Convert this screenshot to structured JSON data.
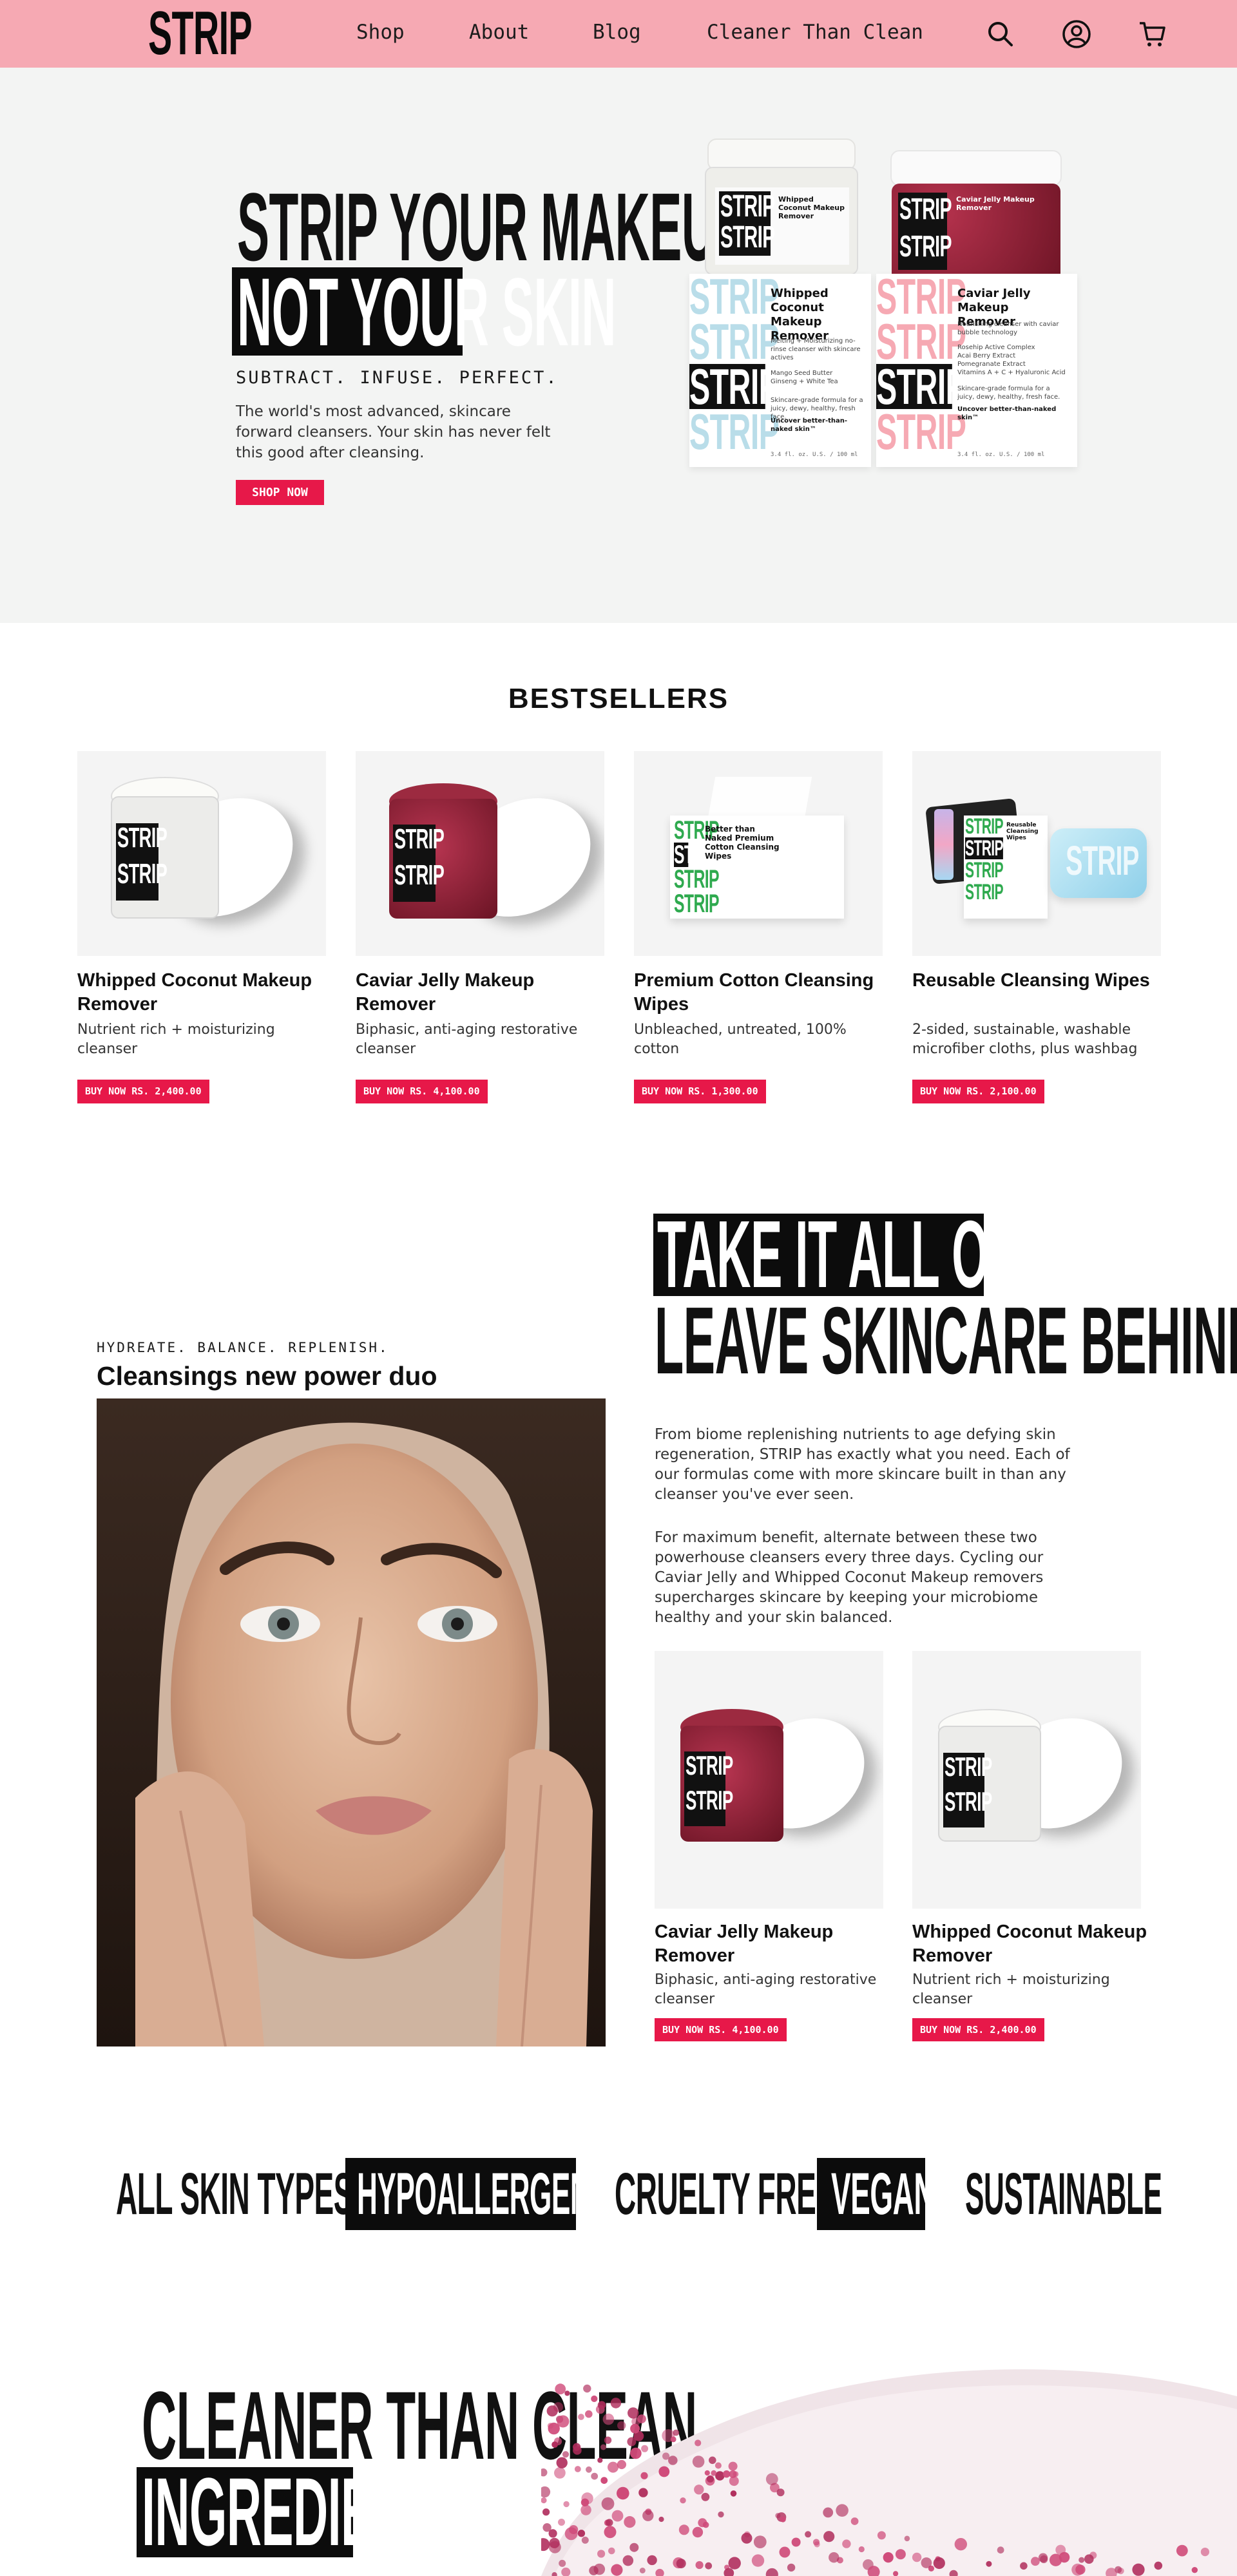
{
  "header": {
    "logo": "STRIP",
    "nav": [
      "Shop",
      "About",
      "Blog",
      "Cleaner Than Clean"
    ],
    "icons": [
      "search-icon",
      "account-icon",
      "cart-icon"
    ],
    "bg_color": "#f6a9b3"
  },
  "hero": {
    "headline_1": "STRIP YOUR MAKEUP",
    "headline_2": "NOT YOUR SKIN",
    "tagline": "SUBTRACT. INFUSE. PERFECT.",
    "description": "The world's most advanced, skincare forward cleansers. Your skin has never felt this good after cleansing.",
    "cta": "SHOP NOW",
    "box_left": {
      "brand": "STRIP",
      "title": "Whipped Coconut Makeup Remover",
      "lines": "Melting + Moisturizing no-rinse cleanser with skincare actives",
      "ingredients": "Mango Seed Butter\nGinseng + White Tea",
      "note": "Skincare-grade formula for a juicy, dewy, healthy, fresh face.",
      "slogan": "Uncover better-than-naked skin™",
      "size": "3.4 fl. oz. U.S. / 100 ml"
    },
    "box_right": {
      "brand": "STRIP",
      "title": "Caviar Jelly Makeup Remover",
      "lines": "Nourishing cleanser with caviar bubble technology",
      "ingredients": "Rosehip Active Complex\nAcai Berry Extract\nPomegranate Extract\nVitamins A + C + Hyaluronic Acid",
      "note": "Skincare-grade formula for a juicy, dewy, healthy, fresh face.",
      "slogan": "Uncover better-than-naked skin™",
      "size": "3.4 fl. oz. U.S. / 100 ml"
    },
    "jar_left_label": "Whipped Coconut Makeup Remover",
    "jar_right_label": "Caviar Jelly Makeup Remover"
  },
  "bestsellers": {
    "title": "BESTSELLERS",
    "products": [
      {
        "name": "Whipped Coconut Makeup Remover",
        "desc": "Nutrient rich + moisturizing cleanser",
        "btn": "BUY NOW   RS. 2,400.00"
      },
      {
        "name": "Caviar Jelly Makeup Remover",
        "desc": "Biphasic, anti-aging restorative cleanser",
        "btn": "BUY NOW   RS. 4,100.00"
      },
      {
        "name": "Premium Cotton Cleansing Wipes",
        "desc": "Unbleached, untreated, 100% cotton",
        "btn": "BUY NOW   RS. 1,300.00"
      },
      {
        "name": "Reusable Cleansing Wipes",
        "desc": "2-sided, sustainable, washable microfiber cloths, plus washbag",
        "btn": "BUY NOW   RS. 2,100.00"
      }
    ],
    "wipes_box_title": "Better than Naked Premium Cotton Cleansing Wipes",
    "reusable_label": "Reusable Cleansing Wipes"
  },
  "duo": {
    "tag": "HYDREATE. BALANCE. REPLENISH.",
    "title": "Cleansings new power duo",
    "headline_1": "TAKE IT ALL OFF,",
    "headline_2": "LEAVE SKINCARE BEHIND",
    "p1": "From biome replenishing nutrients to age defying skin regeneration, STRIP has exactly what you need. Each of our formulas come with more skincare built in than any cleanser you've ever seen.",
    "p2": "For maximum benefit, alternate between these two powerhouse cleansers every three days. Cycling our Caviar Jelly and Whipped Coconut Makeup removers supercharges skincare by keeping your microbiome healthy and your skin balanced.",
    "products": [
      {
        "name": "Caviar Jelly Makeup Remover",
        "desc": "Biphasic, anti-aging restorative cleanser",
        "btn": "BUY NOW   RS. 4,100.00"
      },
      {
        "name": "Whipped Coconut Makeup Remover",
        "desc": "Nutrient rich + moisturizing cleanser",
        "btn": "BUY NOW   RS. 2,400.00"
      }
    ]
  },
  "badges": [
    "ALL SKIN TYPES",
    "HYPOALLERGENIC",
    "CRUELTY FREE",
    "VEGAN",
    "SUSTAINABLE"
  ],
  "ingredients": {
    "headline_1": "CLEANER THAN CLEAN",
    "headline_2": "INGREDIENTS"
  },
  "colors": {
    "accent": "#e71849",
    "hero_bg": "#f3f4f3",
    "caviar": "#8c1f34",
    "strip_blue": "#b9dde9",
    "strip_pink": "#f6a9b3"
  }
}
